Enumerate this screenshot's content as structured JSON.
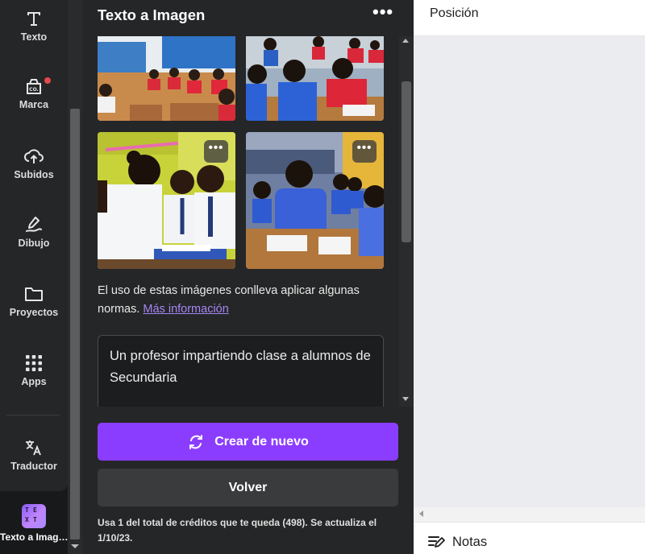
{
  "sidebar": {
    "items": [
      {
        "label": "Texto",
        "icon": "text-icon"
      },
      {
        "label": "Marca",
        "icon": "brand-kit-icon",
        "notification_dot": true
      },
      {
        "label": "Subidos",
        "icon": "cloud-upload-icon"
      },
      {
        "label": "Dibujo",
        "icon": "draw-icon"
      },
      {
        "label": "Proyectos",
        "icon": "folder-icon"
      },
      {
        "label": "Apps",
        "icon": "apps-grid-icon"
      },
      {
        "label": "Traductor",
        "icon": "translate-icon"
      },
      {
        "label": "Texto a Imag…",
        "icon": "text-to-image-icon",
        "active": true
      }
    ]
  },
  "panel": {
    "title": "Texto a Imagen",
    "more_label": "•••",
    "images": [
      {
        "name": "generated-image-1",
        "description": "classroom with students in red uniforms"
      },
      {
        "name": "generated-image-2",
        "description": "students in blue shirts at desks"
      },
      {
        "name": "generated-image-3",
        "description": "smiling students in white shirts with books"
      },
      {
        "name": "generated-image-4",
        "description": "smiling student in blue polo at desk"
      }
    ],
    "tile_more_label": "•••",
    "notice_text": "El uso de estas imágenes conlleva aplicar algunas normas.",
    "notice_link": "Más información",
    "prompt": "Un profesor impartiendo clase a alumnos de Secundaria",
    "regenerate_label": "Crear de nuevo",
    "back_label": "Volver",
    "credits_text": "Usa 1 del total de créditos que te queda (498). Se actualiza el 1/10/23."
  },
  "canvas": {
    "top_label": "Posición",
    "notes_label": "Notas"
  },
  "colors": {
    "accent": "#8b3dff",
    "panel_bg": "#252627",
    "rail_bg": "#18191b",
    "link": "#a785f5",
    "notification": "#e5484d"
  }
}
